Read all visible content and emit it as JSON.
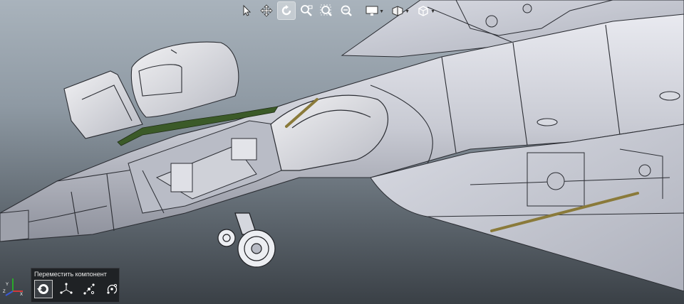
{
  "toolbar": {
    "items": [
      {
        "name": "select-arrow-icon"
      },
      {
        "name": "pan-icon"
      },
      {
        "name": "rotate-view-icon",
        "active": true
      },
      {
        "name": "zoom-to-area-icon"
      },
      {
        "name": "zoom-to-fit-icon"
      },
      {
        "name": "zoom-in-out-icon"
      },
      {
        "name": "display-style-icon"
      },
      {
        "name": "hide-show-icon"
      },
      {
        "name": "view-orientation-cube-icon"
      }
    ]
  },
  "command_panel": {
    "title": "Переместить компонент",
    "tools": [
      {
        "name": "free-move-icon",
        "active": true
      },
      {
        "name": "move-along-xyz-icon"
      },
      {
        "name": "move-along-entity-icon"
      },
      {
        "name": "rotate-about-entity-icon"
      }
    ]
  },
  "triad": {
    "labels": [
      "Y",
      "X",
      "Z"
    ]
  },
  "colors": {
    "background_top": "#a9b3bc",
    "background_bottom": "#3a4046",
    "model_body": "#d2d4dc",
    "model_edges": "#2b2d33",
    "accent_rod": "#8a7a3a",
    "rail_green": "#3b5a28"
  }
}
